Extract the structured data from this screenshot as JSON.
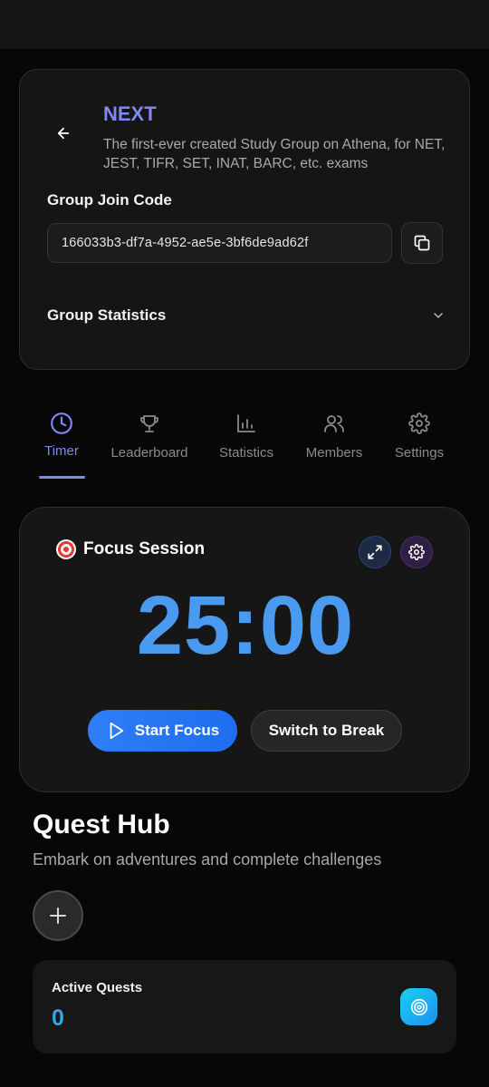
{
  "group": {
    "name": "NEXT",
    "description": "The first-ever created Study Group on Athena, for NET, JEST, TIFR, SET, INAT, BARC, etc. exams",
    "join_code_label": "Group Join Code",
    "join_code": "166033b3-df7a-4952-ae5e-3bf6de9ad62f",
    "statistics_label": "Group Statistics"
  },
  "tabs": [
    {
      "label": "Timer",
      "icon": "clock-icon",
      "active": true
    },
    {
      "label": "Leaderboard",
      "icon": "trophy-icon",
      "active": false
    },
    {
      "label": "Statistics",
      "icon": "bar-chart-icon",
      "active": false
    },
    {
      "label": "Members",
      "icon": "users-icon",
      "active": false
    },
    {
      "label": "Settings",
      "icon": "gear-icon",
      "active": false
    }
  ],
  "focus": {
    "title": "Focus Session",
    "icon": "target-icon",
    "time": "25:00",
    "start_label": "Start Focus",
    "break_label": "Switch to Break"
  },
  "quest": {
    "title": "Quest Hub",
    "subtitle": "Embark on adventures and complete challenges",
    "active_label": "Active Quests",
    "active_count": "0"
  },
  "colors": {
    "accent": "#7f86f5",
    "timer": "#4a9bf0",
    "primary_button": "#2f7df6",
    "quest_count": "#2ea8e6"
  }
}
